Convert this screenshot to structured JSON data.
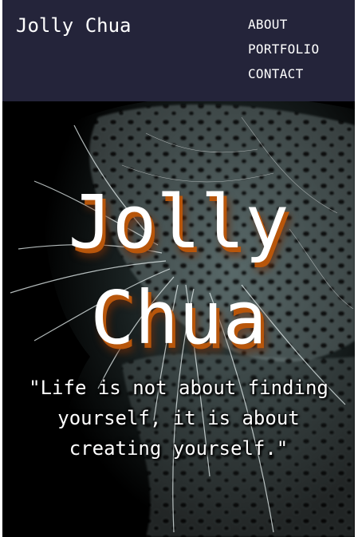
{
  "navbar": {
    "brand": "Jolly Chua",
    "links": [
      "ABOUT",
      "PORTFOLIO",
      "CONTACT"
    ]
  },
  "hero": {
    "title_line1": "Jolly",
    "title_line2": "Chua",
    "quote": "\"Life is not about finding yourself, it is about creating yourself.\"",
    "background": "leopard-fractal-art"
  },
  "colors": {
    "navbar_bg": "#24243a",
    "text": "#ffffff",
    "title_shadow": "#b8560b",
    "hero_bg": "#000000"
  }
}
